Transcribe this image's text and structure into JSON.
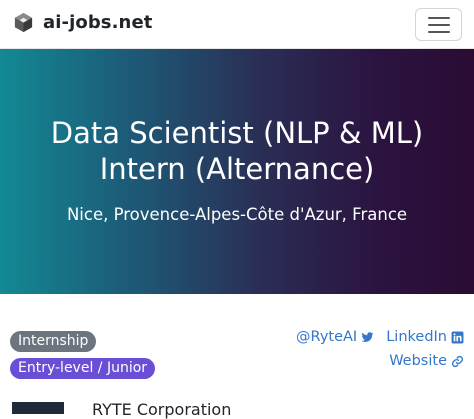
{
  "navbar": {
    "brand_text": "ai-jobs.net",
    "logo_icon": "cube-logo-icon",
    "menu_icon": "hamburger-menu-icon"
  },
  "hero": {
    "title_line1": "Data Scientist (NLP & ML)",
    "title_line2": "Intern (Alternance)",
    "location": "Nice, Provence-Alpes-Côte d'Azur, France",
    "gradient_start": "#128994",
    "gradient_end": "#2a0c33"
  },
  "badges": [
    {
      "label": "Internship",
      "color": "#6c757d"
    },
    {
      "label": "Entry-level / Junior",
      "color": "#6a4fd6"
    }
  ],
  "links": {
    "twitter": {
      "label": "@RyteAI",
      "icon": "twitter-icon"
    },
    "linkedin": {
      "label": "LinkedIn",
      "icon": "linkedin-icon"
    },
    "website": {
      "label": "Website",
      "icon": "external-link-icon"
    }
  },
  "company": {
    "name": "RYTE Corporation"
  }
}
